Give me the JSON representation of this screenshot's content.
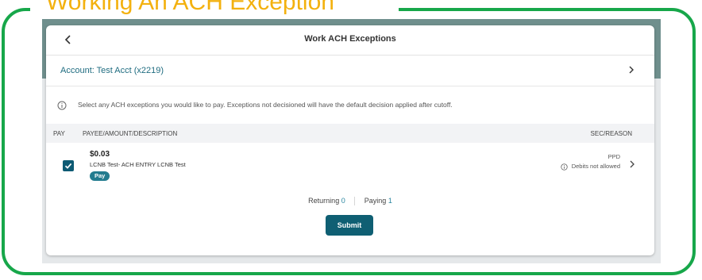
{
  "frame": {
    "title": "Working An ACH Exception"
  },
  "header": {
    "title": "Work ACH Exceptions",
    "back_icon": "chevron-left-icon"
  },
  "account": {
    "label": "Account: Test Acct (x2219)",
    "chevron_icon": "chevron-right-icon"
  },
  "info": {
    "icon": "info-circle-icon",
    "text": "Select any ACH exceptions you would like to pay. Exceptions not decisioned will have the default decision applied after cutoff."
  },
  "table": {
    "columns": {
      "pay": "PAY",
      "payee": "PAYEE/AMOUNT/DESCRIPTION",
      "sec": "SEC/REASON"
    },
    "rows": [
      {
        "checked": true,
        "amount": "$0.03",
        "description": "LCNB Test- ACH ENTRY LCNB Test",
        "badge": "Pay",
        "sec_code": "PPD",
        "reason": "Debits not allowed"
      }
    ]
  },
  "summary": {
    "returning_label": "Returning",
    "returning_count": "0",
    "paying_label": "Paying",
    "paying_count": "1"
  },
  "actions": {
    "submit_label": "Submit"
  },
  "colors": {
    "frame_green": "#17a74a",
    "title_gold": "#f3b10f",
    "primary": "#0f5f73",
    "link": "#1f6c80"
  }
}
